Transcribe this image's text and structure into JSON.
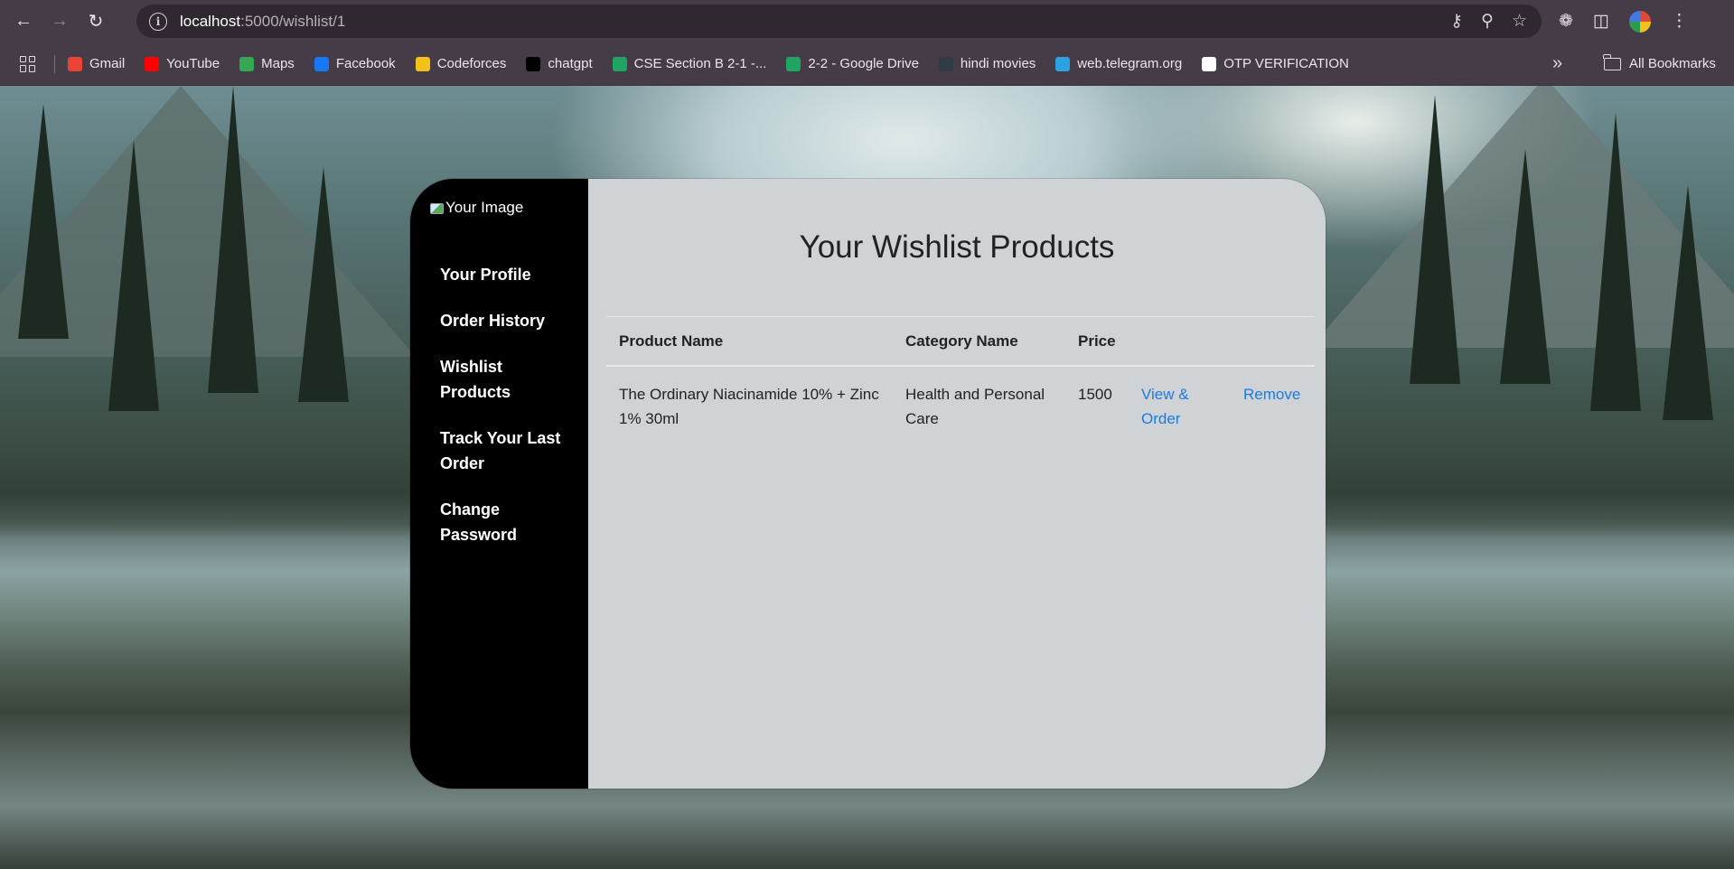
{
  "browser": {
    "url_host": "localhost",
    "url_path": ":5000/wishlist/1",
    "bookmarks": [
      {
        "label": "Gmail",
        "color": "#ea4335",
        "icon": "gmail-icon"
      },
      {
        "label": "YouTube",
        "color": "#ff0000",
        "icon": "youtube-icon"
      },
      {
        "label": "Maps",
        "color": "#34a853",
        "icon": "maps-icon"
      },
      {
        "label": "Facebook",
        "color": "#1877f2",
        "icon": "facebook-icon"
      },
      {
        "label": "Codeforces",
        "color": "#f2c21b",
        "icon": "codeforces-icon"
      },
      {
        "label": "chatgpt",
        "color": "#000000",
        "icon": "chatgpt-icon"
      },
      {
        "label": "CSE Section B 2-1 -...",
        "color": "#1fa463",
        "icon": "google-drive-icon"
      },
      {
        "label": "2-2 - Google Drive",
        "color": "#1fa463",
        "icon": "google-drive-icon"
      },
      {
        "label": "hindi movies",
        "color": "#2f3b46",
        "icon": "movies-icon"
      },
      {
        "label": "web.telegram.org",
        "color": "#2aa3e0",
        "icon": "telegram-icon"
      },
      {
        "label": "OTP VERIFICATION",
        "color": "#ffffff",
        "icon": "github-icon"
      }
    ],
    "all_bookmarks": "All Bookmarks"
  },
  "sidebar": {
    "brand_alt": "Your Image",
    "items": [
      {
        "label": "Your Profile"
      },
      {
        "label": "Order History"
      },
      {
        "label": "Wishlist Products"
      },
      {
        "label": "Track Your Last Order"
      },
      {
        "label": "Change Password"
      }
    ]
  },
  "main": {
    "title": "Your Wishlist Products",
    "columns": [
      "Product Name",
      "Category Name",
      "Price"
    ],
    "rows": [
      {
        "product": "The Ordinary Niacinamide 10% + Zinc 1% 30ml",
        "category": "Health and Personal Care",
        "price": "1500",
        "view_label": "View & Order",
        "remove_label": "Remove"
      }
    ]
  },
  "colors": {
    "sidebar_bg": "#000000",
    "main_bg": "#cfd3d5",
    "link": "#1a7be6"
  }
}
